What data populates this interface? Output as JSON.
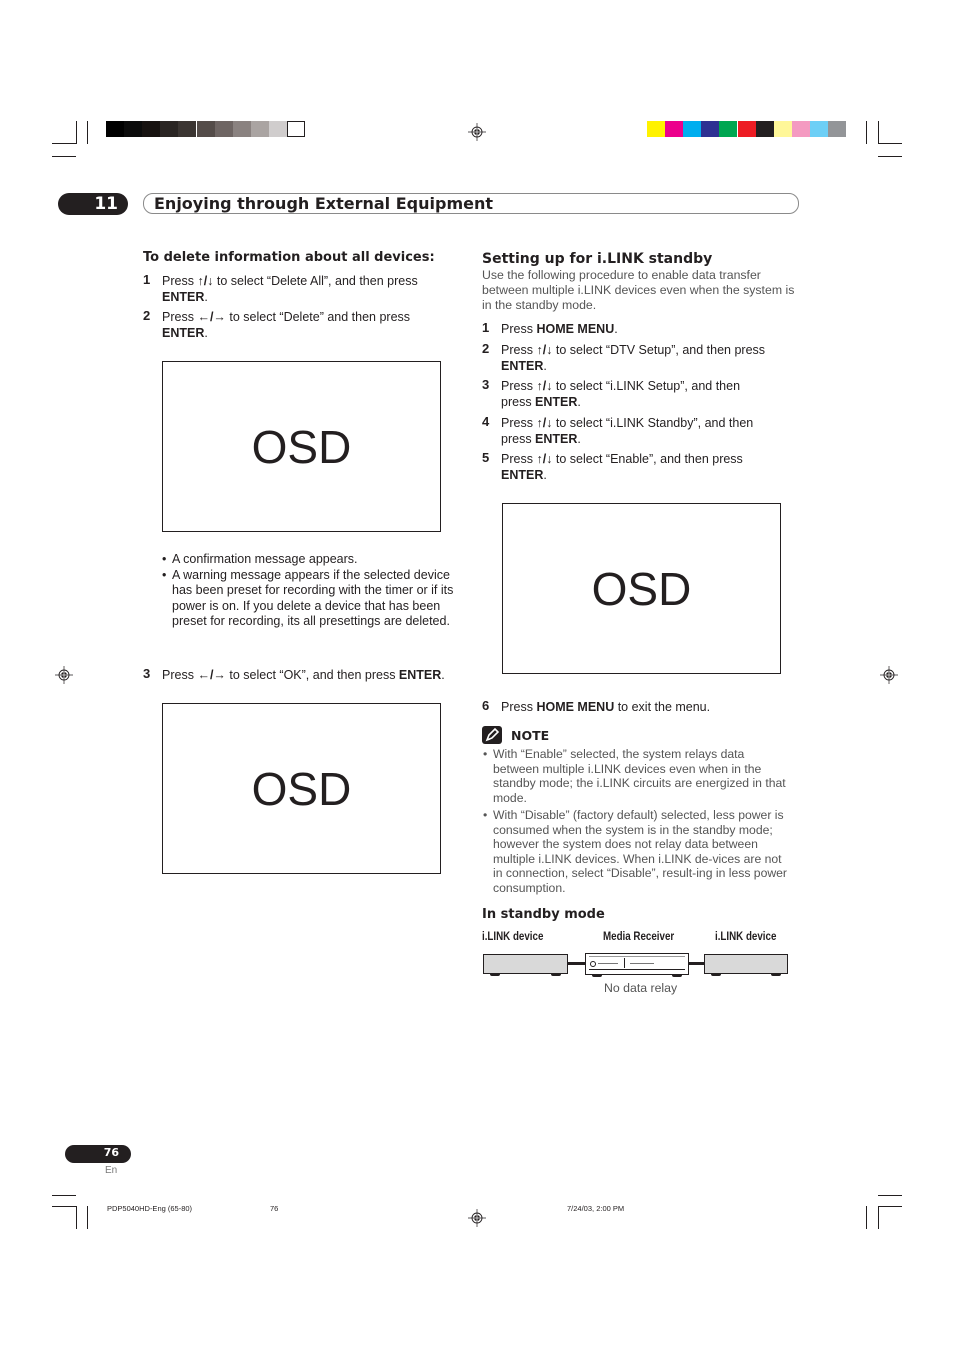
{
  "print_marks": {
    "grayscale_swatches": [
      "#000000",
      "#0b0b0b",
      "#171210",
      "#2a2523",
      "#3b3532",
      "#544c49",
      "#6e6563",
      "#8a8280",
      "#aaa4a2",
      "#d0cdcd",
      "#ffffff"
    ],
    "color_swatches": [
      "#fff200",
      "#ec008c",
      "#00aeef",
      "#2e3192",
      "#00a651",
      "#ed1c24",
      "#231f20",
      "#fff799",
      "#f49ac1",
      "#6dcff6",
      "#939598"
    ]
  },
  "header": {
    "chapter_number": "11",
    "chapter_title": "Enjoying through External Equipment"
  },
  "left_column": {
    "heading": "To delete information about all devices:",
    "steps": [
      {
        "num": "1",
        "pre": "Press ",
        "keys": "↑/↓",
        "post": " to select “Delete All”, and then press",
        "enter": "ENTER",
        "end": "."
      },
      {
        "num": "2",
        "pre": "Press ",
        "keys": "←/→",
        "post": " to select “Delete” and then press",
        "enter": "ENTER",
        "end": "."
      }
    ],
    "osd_1": "OSD",
    "bullets": [
      "A confirmation message appears.",
      "A warning message appears if the selected device has been preset for recording with the timer or if its power is on. If you delete a device that has been preset for recording, its all presettings are deleted."
    ],
    "step3": {
      "num": "3",
      "pre": "Press ",
      "keys": "←/→",
      "post": " to select “OK”, and then press ",
      "enter": "ENTER",
      "end": "."
    },
    "osd_2": "OSD"
  },
  "right_column": {
    "heading": "Setting up for i.LINK standby",
    "intro": "Use the following procedure to enable data transfer between multiple i.LINK devices even when the system is in the standby mode.",
    "step1": {
      "num": "1",
      "pre": "Press ",
      "bold": "HOME MENU",
      "end": "."
    },
    "steps": [
      {
        "num": "2",
        "pre": "Press ",
        "keys": "↑/↓",
        "post": " to select “DTV Setup”, and then press",
        "line2_pre": "",
        "enter": "ENTER",
        "end": "."
      },
      {
        "num": "3",
        "pre": "Press ",
        "keys": "↑/↓",
        "post": " to select “i.LINK Setup”, and then",
        "line2_pre": "press ",
        "enter": "ENTER",
        "end": "."
      },
      {
        "num": "4",
        "pre": "Press ",
        "keys": "↑/↓",
        "post": " to select “i.LINK Standby”, and then",
        "line2_pre": "press ",
        "enter": "ENTER",
        "end": "."
      },
      {
        "num": "5",
        "pre": "Press ",
        "keys": "↑/↓",
        "post": " to select “Enable”, and then press",
        "line2_pre": "",
        "enter": "ENTER",
        "end": "."
      }
    ],
    "osd_3": "OSD",
    "step6": {
      "num": "6",
      "pre": "Press ",
      "bold": "HOME MENU",
      "post": " to exit the menu."
    },
    "note_label": "NOTE",
    "notes": [
      "With “Enable” selected, the system relays data between multiple i.LINK devices even when in the standby mode; the i.LINK circuits are energized in that mode.",
      "With “Disable” (factory default) selected, less power is consumed when the system is in the standby mode; however the system does not relay data between multiple i.LINK devices. When i.LINK de-vices are not in connection, select “Disable”, result-ing in less power consumption."
    ],
    "diagram": {
      "title": "In standby mode",
      "left_label": "i.LINK device",
      "center_label": "Media Receiver",
      "right_label": "i.LINK device",
      "caption": "No data relay"
    }
  },
  "footer": {
    "page_number": "76",
    "language": "En",
    "file_info": "PDP5040HD-Eng (65-80)",
    "file_page": "76",
    "timestamp": "7/24/03, 2:00 PM"
  }
}
